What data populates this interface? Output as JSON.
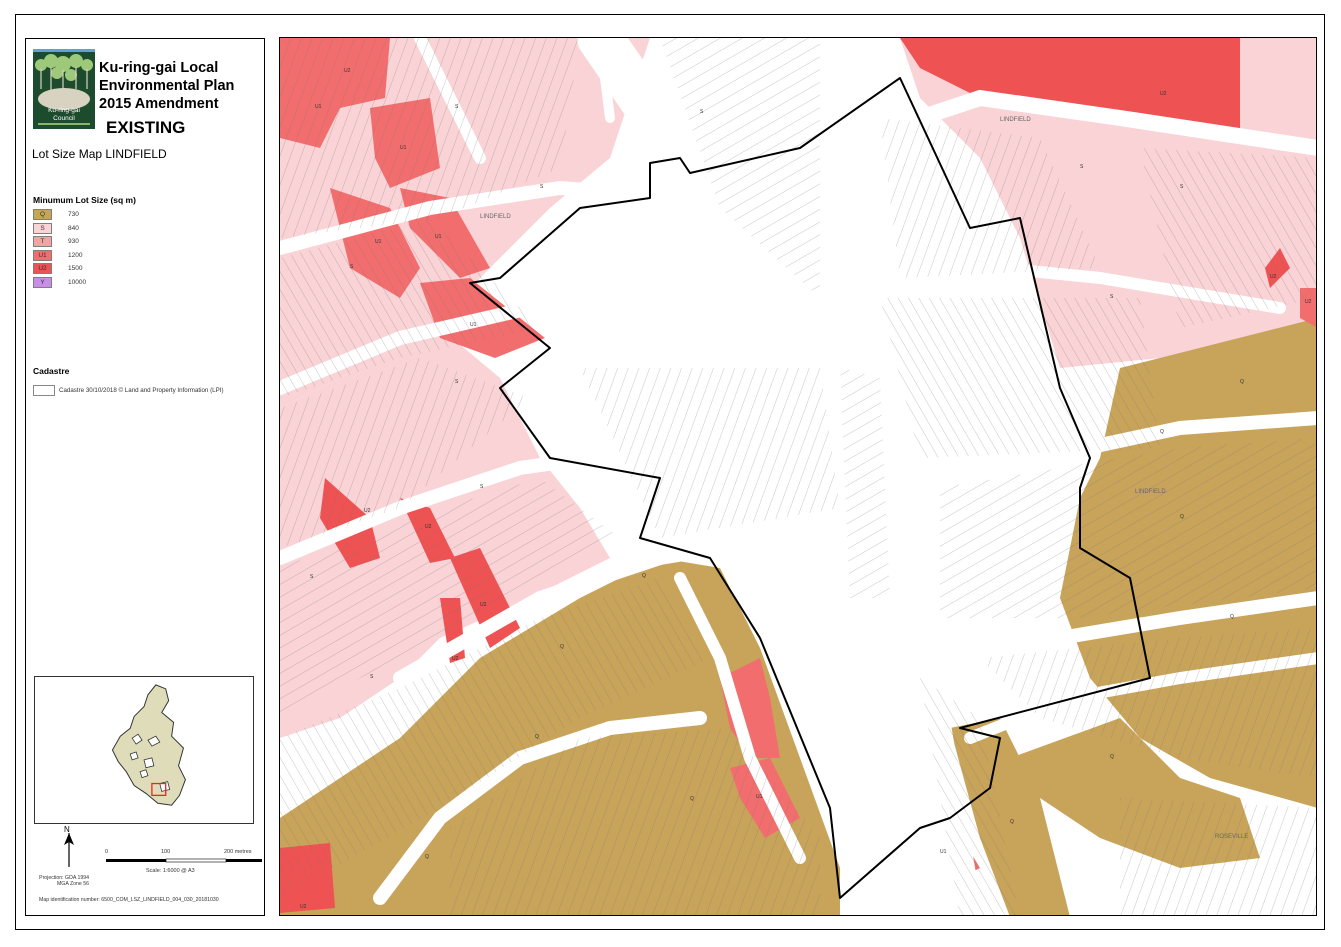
{
  "header": {
    "title_line1": "Ku-ring-gai Local",
    "title_line2": "Environmental Plan",
    "title_line3": "2015 Amendment",
    "status": "EXISTING",
    "map_title": "Lot Size Map LINDFIELD",
    "logo_text_line1": "Ku-ring-gai",
    "logo_text_line2": "Council"
  },
  "legend": {
    "title": "Minumum Lot Size (sq m)",
    "items": [
      {
        "code": "Q",
        "value": "730",
        "color": "#C8A35A"
      },
      {
        "code": "S",
        "value": "840",
        "color": "#F9D3D6"
      },
      {
        "code": "T",
        "value": "930",
        "color": "#F4A3A3"
      },
      {
        "code": "U1",
        "value": "1200",
        "color": "#F26D6D"
      },
      {
        "code": "U2",
        "value": "1500",
        "color": "#EE5252"
      },
      {
        "code": "Y",
        "value": "10000",
        "color": "#C98FE8"
      }
    ]
  },
  "cadastre": {
    "title": "Cadastre",
    "text": "Cadastre 30/10/2018 © Land and Property Information (LPI)"
  },
  "north": "N",
  "projection": {
    "line1": "Projection: GDA 1994",
    "line2": "MGA Zone 56"
  },
  "scale": {
    "tick0": "0",
    "tick1": "100",
    "tick2": "200 metres",
    "text": "Scale: 1:6000   @ A3"
  },
  "map_id": "Map identification number: 6500_COM_LSZ_LINDFIELD_004_030_20181030",
  "map": {
    "zone_labels": [
      "Q",
      "S",
      "U1",
      "U2"
    ],
    "suburb_labels": [
      "LINDFIELD",
      "LINDFIELD",
      "LINDFIELD",
      "ROSEVILLE"
    ],
    "colors": {
      "Q": "#C8A35A",
      "S": "#F9D3D6",
      "U1": "#F26D6D",
      "U2": "#EE5252",
      "road": "#ffffff",
      "cad_line": "#7a7a7a",
      "boundary": "#000000"
    }
  }
}
